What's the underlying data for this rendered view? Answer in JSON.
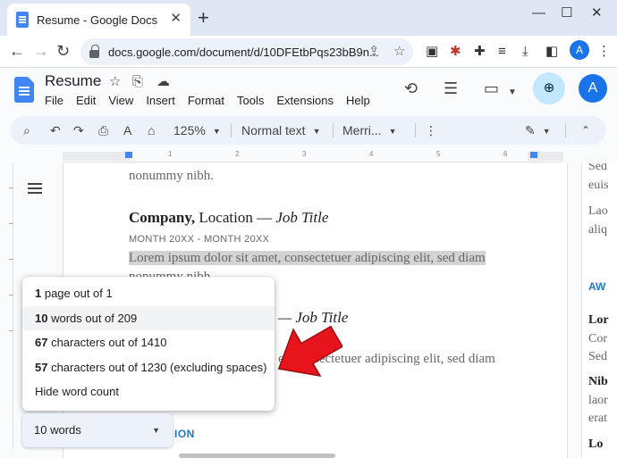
{
  "browser": {
    "tab_title": "Resume - Google Docs",
    "tab_close": "✕",
    "new_tab": "+",
    "url": "docs.google.com/document/d/10DFEtbPqs23bB9n...",
    "avatar_letter": "A"
  },
  "docs": {
    "title": "Resume",
    "menu": [
      "File",
      "Edit",
      "View",
      "Insert",
      "Format",
      "Tools",
      "Extensions",
      "Help"
    ],
    "avatar_letter": "A"
  },
  "toolbar": {
    "zoom": "125%",
    "style": "Normal text",
    "font": "Merri..."
  },
  "ruler_labels": [
    "1",
    "2",
    "3",
    "4",
    "5",
    "6"
  ],
  "document": {
    "line1": "nonummy nibh.",
    "company": "Company,",
    "location": " Location — ",
    "job_title": "Job Title",
    "dates": "MONTH 20XX - MONTH 20XX",
    "lorem1": "Lorem ipsum dolor sit amet, consectetuer adipiscing elit, sed diam",
    "lorem1b": "nonummy nibh.",
    "heading2_rest": "— Job Title",
    "lorem2_rest": "et, consectetuer adipiscing elit, sed diam",
    "section_partial": "ION"
  },
  "page2": {
    "lines": [
      "Sed",
      "euis",
      "Lao",
      "aliq",
      "AW",
      "Lor",
      "Cor",
      "Sed",
      "Nib",
      "laor",
      "erat",
      "Lo"
    ]
  },
  "word_count_menu": {
    "items": [
      {
        "count": "1",
        "text": " page out of 1"
      },
      {
        "count": "10",
        "text": " words out of 209"
      },
      {
        "count": "67",
        "text": " characters out of 1410"
      },
      {
        "count": "57",
        "text": " characters out of 1230 (excluding spaces)"
      }
    ],
    "hide_label": "Hide word count",
    "pill_label": "10 words"
  },
  "colors": {
    "arrow": "#e8141b",
    "accent": "#1a73e8",
    "section_heading": "#2079c7"
  }
}
